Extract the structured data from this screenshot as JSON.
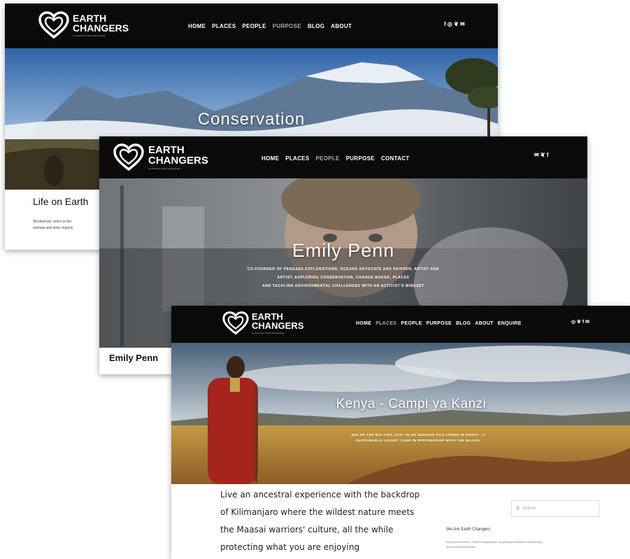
{
  "brand": {
    "line1": "EARTH",
    "line2": "CHANGERS",
    "tagline": "An Adventure Travel Changemaker"
  },
  "screen1": {
    "menu": [
      {
        "label": "HOME"
      },
      {
        "label": "PLACES"
      },
      {
        "label": "PEOPLE"
      },
      {
        "label": "PURPOSE"
      },
      {
        "label": "BLOG"
      },
      {
        "label": "ABOUT"
      }
    ],
    "active_menu": "PURPOSE",
    "social": "f ◎ ❦ ✉",
    "hero_title": "Conservation",
    "heading": "Life on Earth",
    "body_line1": "'Biodiversity' refers to bio",
    "body_line2": "animals and other organis"
  },
  "screen2": {
    "menu": [
      {
        "label": "HOME"
      },
      {
        "label": "PLACES"
      },
      {
        "label": "PEOPLE"
      },
      {
        "label": "PURPOSE"
      },
      {
        "label": "CONTACT"
      }
    ],
    "active_menu": "PEOPLE",
    "social": "✉ ❦ f",
    "hero_title": "Emily Penn",
    "hero_sub1": "CO-FOUNDER OF PANGAEA EXPLORATIONS, OCEANS ADVOCATE AND SKIPPER, ARTIST AND",
    "hero_sub2": "ARTIST, EXPLORING CONSERVATION, CHANGE MAKER, PLACES",
    "hero_sub3": "AND TACKLING ENVIRONMENTAL CHALLENGES WITH AN ACTIVIST'S MINDSET",
    "heading": "Emily Penn"
  },
  "screen3": {
    "menu": [
      {
        "label": "HOME"
      },
      {
        "label": "PLACES"
      },
      {
        "label": "PEOPLE"
      },
      {
        "label": "PURPOSE"
      },
      {
        "label": "BLOG"
      },
      {
        "label": "ABOUT"
      },
      {
        "label": "ENQUIRE"
      }
    ],
    "active_menu": "PLACES",
    "social": "◎ ❦ f ✉",
    "hero_title": "Kenya - Campi ya Kanzi",
    "hero_sub1": "SEE UP THE BIG FIVE, STAY IN AN AMAZING ECO-LODGE IN KENYA - A",
    "hero_sub2": "SUSTAINABLE LUXURY CAMP IN PARTNERSHIP WITH THE MAASAI",
    "body_lines": [
      "Live an ancestral experience with the backdrop",
      "of Kilimanjaro where the wildest nature meets",
      "the Maasai warriors' culture, all the while",
      "protecting what you are enjoying"
    ],
    "search_placeholder": "Search",
    "sidebar_heading": "We Are Earth Changers",
    "sidebar_text1": "We're an Adventure Travel Changemaker, supporting Destination Stewardship",
    "sidebar_text2": "and environmental work."
  },
  "colors": {
    "nav": "#0a0a0a",
    "active": "#a9a9a9",
    "text": "#111111"
  }
}
